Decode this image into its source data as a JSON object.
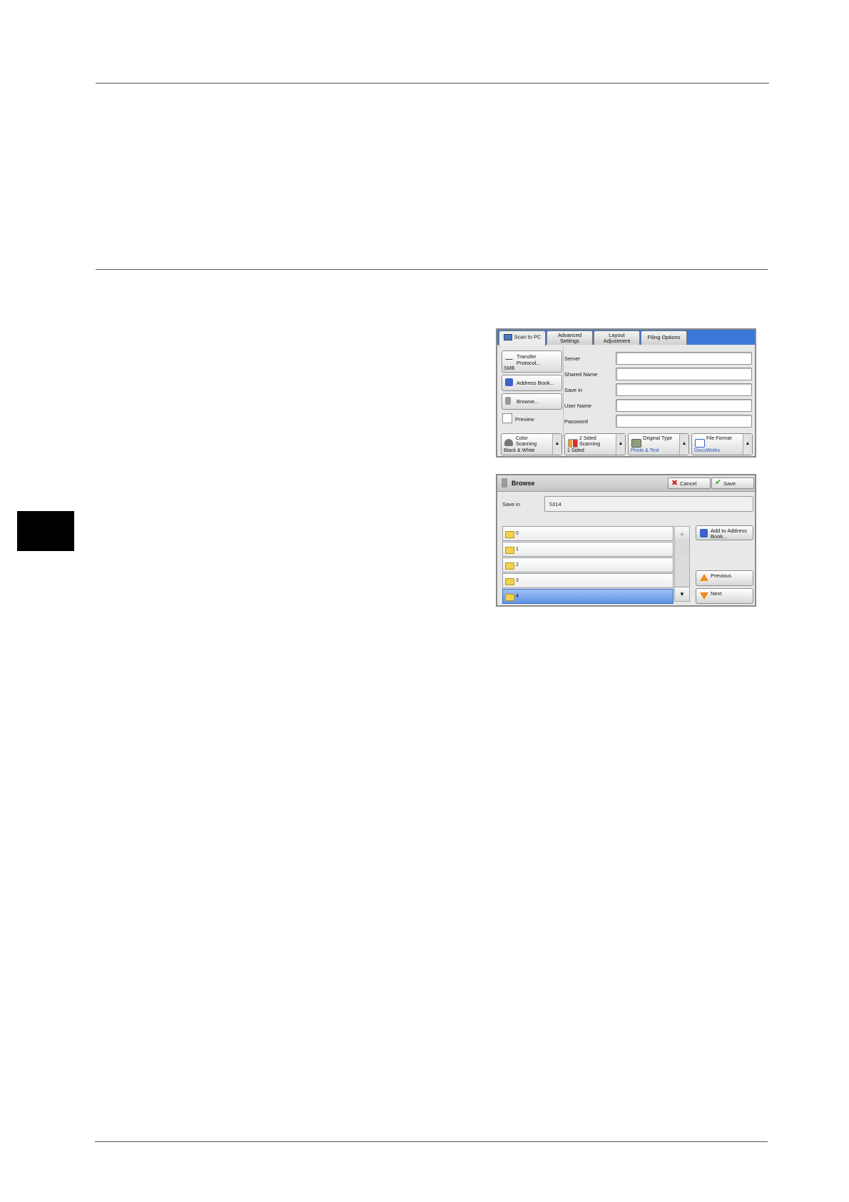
{
  "scan_panel": {
    "tabs": [
      "Scan to PC",
      "Advanced\nSettings",
      "Layout\nAdjustment",
      "Filing Options"
    ],
    "transfer_protocol": {
      "label": "Transfer\nProtocol...",
      "value": "SMB"
    },
    "address_book_label": "Address Book...",
    "browse_label": "Browse...",
    "preview_label": "Preview",
    "fields": [
      "Server",
      "Shared Name",
      "Save in",
      "User Name",
      "Password"
    ],
    "features": [
      {
        "title": "Color\nScanning",
        "value": "Black & White",
        "icon": "color-scanning-icon"
      },
      {
        "title": "2 Sided\nScanning",
        "value": "1 Sided",
        "icon": "two-sided-icon"
      },
      {
        "title": "Original Type",
        "value": "Photo & Text",
        "icon": "original-type-icon"
      },
      {
        "title": "File Format",
        "value": "DocuWorks",
        "icon": "file-format-icon"
      }
    ]
  },
  "browse_panel": {
    "title": "Browse",
    "cancel_label": "Cancel",
    "save_label": "Save",
    "save_in_label": "Save in",
    "save_in_value": "\\\\314",
    "folders": [
      "0",
      "1",
      "2",
      "3",
      "4"
    ],
    "selected_folder": "4",
    "add_to_address_book_label": "Add to Address\nBook...",
    "previous_label": "Previous",
    "next_label": "Next"
  }
}
